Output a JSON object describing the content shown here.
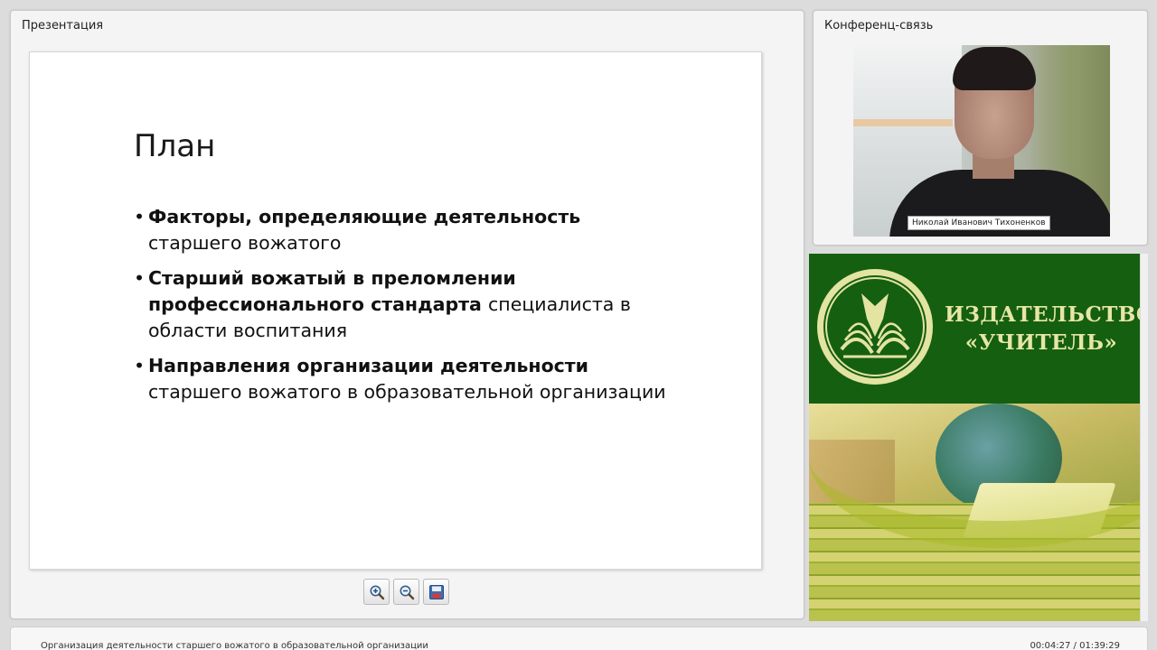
{
  "presentation": {
    "panel_title": "Презентация",
    "slide": {
      "title": "План",
      "bullets": [
        {
          "bold": "Факторы, определяющие деятельность",
          "rest": "старшего вожатого"
        },
        {
          "bold": "Старший вожатый в преломлении профессионального стандарта",
          "rest": "специалиста в области воспитания"
        },
        {
          "bold": "Направления организации деятельности",
          "rest": "старшего вожатого в образовательной организации"
        }
      ]
    },
    "toolbar": {
      "zoom_in_icon": "zoom-in-icon",
      "zoom_out_icon": "zoom-out-icon",
      "save_icon": "floppy-disk-icon"
    }
  },
  "conference": {
    "panel_title": "Конференц-связь",
    "participant_name": "Николай Иванович Тихоненков"
  },
  "banner": {
    "line1": "ИЗДАТЕЛЬСТВО",
    "line2": "«УЧИТЕЛЬ»",
    "colors": {
      "background": "#155f10",
      "text": "#e7e6a6"
    }
  },
  "footer": {
    "title": "Организация деятельности старшего вожатого в образовательной организации",
    "time": "00:04:27 / 01:39:29"
  }
}
